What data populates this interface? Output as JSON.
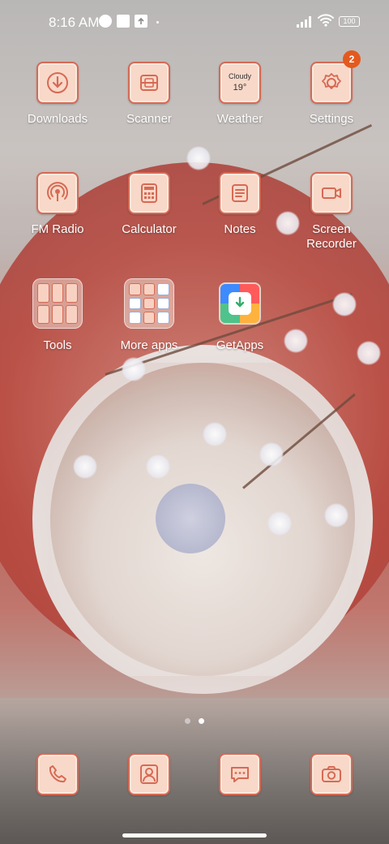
{
  "status_bar": {
    "time": "8:16 AM",
    "battery": "100",
    "icons": [
      "photo-icon",
      "square-icon",
      "upload-icon",
      "signal-icon",
      "wifi-icon",
      "battery-icon"
    ]
  },
  "apps": [
    {
      "label": "Downloads",
      "icon": "download-icon"
    },
    {
      "label": "Scanner",
      "icon": "scanner-icon"
    },
    {
      "label": "Weather",
      "icon": "weather-icon",
      "condition": "Cloudy",
      "temp": "19°"
    },
    {
      "label": "Settings",
      "icon": "gear-icon",
      "badge": "2"
    },
    {
      "label": "FM Radio",
      "icon": "radio-icon"
    },
    {
      "label": "Calculator",
      "icon": "calculator-icon"
    },
    {
      "label": "Notes",
      "icon": "notes-icon"
    },
    {
      "label": "Screen\nRecorder",
      "icon": "video-icon"
    },
    {
      "label": "Tools",
      "icon": "folder-icon"
    },
    {
      "label": "More apps",
      "icon": "folder-icon"
    },
    {
      "label": "GetApps",
      "icon": "getapps-icon"
    }
  ],
  "page_indicator": {
    "pages": 2,
    "active": 2
  },
  "dock": [
    {
      "name": "Phone",
      "icon": "phone-icon"
    },
    {
      "name": "Contacts",
      "icon": "contact-icon"
    },
    {
      "name": "Messages",
      "icon": "message-icon"
    },
    {
      "name": "Camera",
      "icon": "camera-icon"
    }
  ],
  "colors": {
    "icon_fill": "#f8d8c8",
    "icon_stroke": "#d66a55",
    "badge": "#e35a1e"
  }
}
